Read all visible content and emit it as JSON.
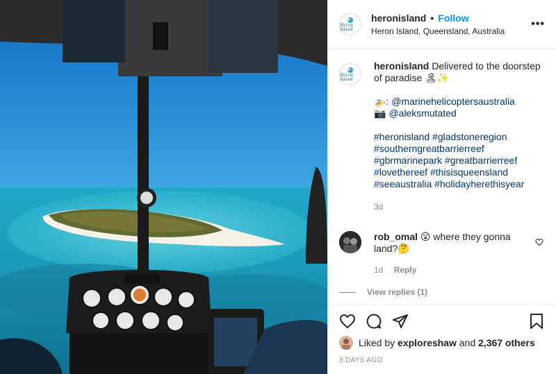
{
  "post": {
    "username": "heronisland",
    "follow_label": "Follow",
    "dot": "•",
    "location": "Heron Island, Queensland, Australia",
    "more_label": "•••",
    "avatar_text": "Heron Island",
    "photo_alt_icon": "helicopter-cockpit-photo"
  },
  "caption": {
    "username": "heronisland",
    "text": "Delivered to the doorstep of paradise 🏝✨",
    "credit1_emoji": "🚁:",
    "credit1_tag": "@marinehelicoptersaustralia",
    "credit2_emoji": "📷",
    "credit2_tag": "@aleksmutated",
    "hashtags_lines": [
      "#heronisland #gladstoneregion",
      "#southerngreatbarrierreef",
      "#gbrmarinepark #greatbarrierreef",
      "#lovethereef #thisisqueensland",
      "#seeaustralia #holidayherethisyear"
    ],
    "time": "3d"
  },
  "comment": {
    "username": "rob_omal",
    "text": "😮 where they gonna land?🤔",
    "time": "1d",
    "reply_label": "Reply",
    "view_replies": "View replies (1)"
  },
  "actions": {
    "liked_by_prefix": "Liked by",
    "liked_by_user": "exploreshaw",
    "liked_by_and": "and",
    "liked_by_others": "2,367 others",
    "date": "3 DAYS AGO"
  },
  "colors": {
    "link": "#0095f6",
    "hashtag": "#00376b",
    "muted": "#8e8e8e"
  }
}
